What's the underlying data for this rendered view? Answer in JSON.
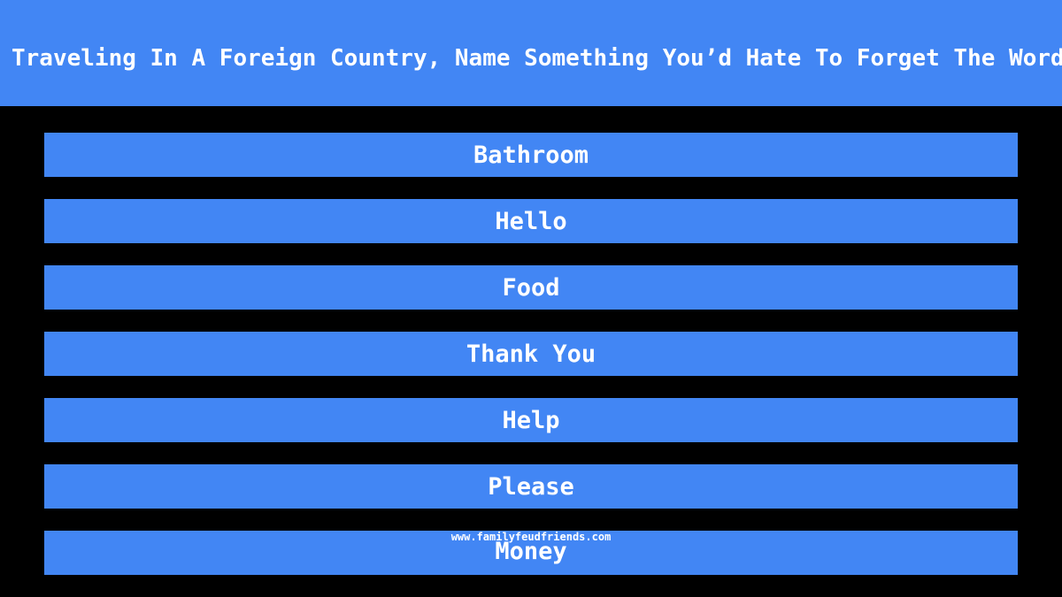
{
  "question": "While Traveling In A Foreign Country, Name Something You’d Hate To Forget The Words For",
  "answers": [
    "Bathroom",
    "Hello",
    "Food",
    "Thank You",
    "Help",
    "Please",
    "Money"
  ],
  "watermark": "www.familyfeudfriends.com",
  "colors": {
    "accent": "#4286f4",
    "background": "#000000",
    "text": "#ffffff"
  }
}
